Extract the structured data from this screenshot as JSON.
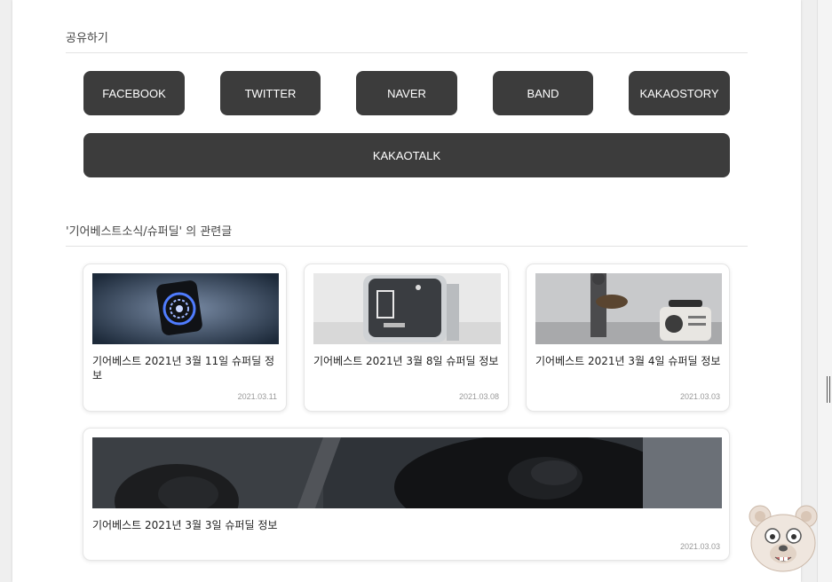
{
  "share": {
    "heading": "공유하기",
    "buttons": [
      "FACEBOOK",
      "TWITTER",
      "NAVER",
      "BAND",
      "KAKAOSTORY"
    ],
    "wide_button": "KAKAOTALK"
  },
  "related": {
    "heading": "'기어베스트소식/슈퍼딜' 의 관련글",
    "posts": [
      {
        "title": "기어베스트 2021년 3월 11일 슈퍼딜 정보",
        "date": "2021.03.11",
        "thumb": "black smart speaker with blue light ring"
      },
      {
        "title": "기어베스트 2021년 3월 8일 슈퍼딜 정보",
        "date": "2021.03.08",
        "thumb": "silver cube air quality monitor"
      },
      {
        "title": "기어베스트 2021년 3월 4일 슈퍼딜 정보",
        "date": "2021.03.03",
        "thumb": "guitarist beside retro speaker"
      },
      {
        "title": "기어베스트 2021년 3월 3일 슈퍼딜 정보",
        "date": "2021.03.03",
        "thumb": "black wireless earbuds and case"
      }
    ]
  },
  "colors": {
    "button_bg": "#3c3c3c",
    "button_text": "#ffffff",
    "page_bg": "#ffffff",
    "outer_bg": "#efefef"
  },
  "icons": {
    "floating_mascot": "bear-face-icon"
  }
}
